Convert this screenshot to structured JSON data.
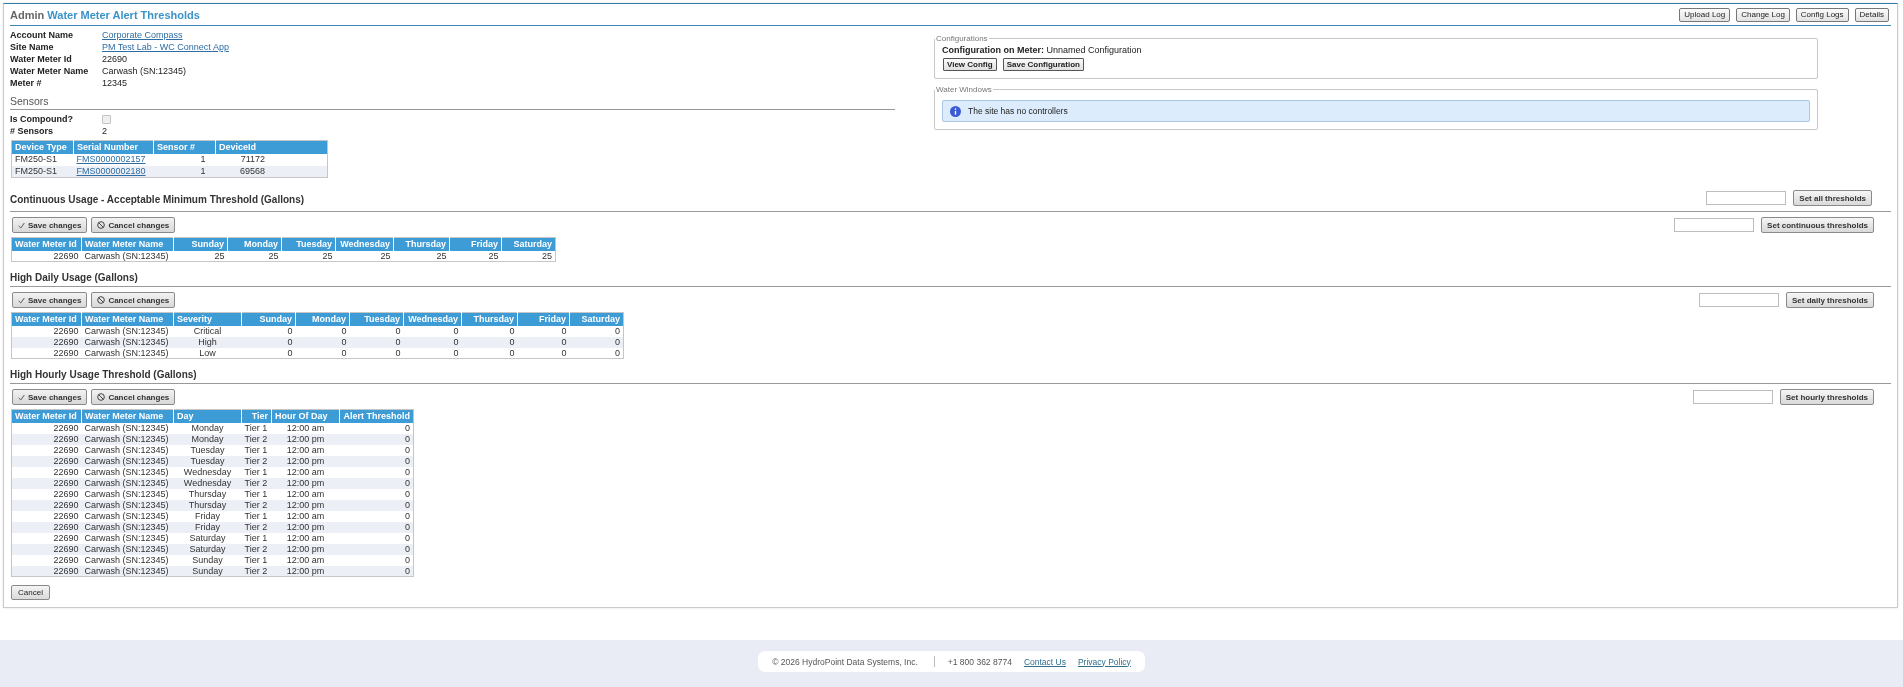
{
  "header": {
    "title": {
      "prefix": "Admin",
      "main": "Water Meter Alert Thresholds"
    },
    "buttons": [
      "Upload Log",
      "Change Log",
      "Config Logs",
      "Details"
    ]
  },
  "details": [
    {
      "label": "Account Name",
      "value": "Corporate Compass",
      "kind": "link"
    },
    {
      "label": "Site Name",
      "value": "PM Test Lab - WC Connect App",
      "kind": "link"
    },
    {
      "label": "Water Meter Id",
      "value": "22690",
      "kind": "text"
    },
    {
      "label": "Water Meter Name",
      "value": "Carwash (SN:12345)",
      "kind": "text"
    },
    {
      "label": "Meter #",
      "value": "12345",
      "kind": "text"
    }
  ],
  "sensors": {
    "title": "Sensors",
    "compound": {
      "label": "Is Compound?",
      "checked": false,
      "disabled": true
    },
    "count": {
      "label": "# Sensors",
      "value": "2"
    },
    "table": {
      "columns": [
        "Device Type",
        "Serial Number",
        "Sensor #",
        "DeviceId"
      ],
      "rows": [
        [
          "FM250-S1",
          "FMS0000002157",
          "1",
          "71172"
        ],
        [
          "FM250-S1",
          "FMS0000002180",
          "1",
          "69568"
        ]
      ]
    }
  },
  "configurations": {
    "legend": "Configurations",
    "label": "Configuration on Meter:",
    "value": "Unnamed Configuration",
    "buttons": [
      "View Config",
      "Save Configuration"
    ]
  },
  "water_windows": {
    "legend": "Water Windows",
    "message": "The site has no controllers"
  },
  "sections": [
    {
      "kind": "continuous",
      "title": "Continuous Usage - Acceptable Minimum Threshold (Gallons)",
      "header_action": "Set all thresholds",
      "buttons": [
        {
          "kind": "save",
          "label": "Save changes"
        },
        {
          "kind": "cancel",
          "label": "Cancel changes"
        }
      ],
      "set_button": "Set continuous thresholds",
      "table": {
        "columns": [
          "Water Meter Id",
          "Water Meter Name",
          "Sunday",
          "Monday",
          "Tuesday",
          "Wednesday",
          "Thursday",
          "Friday",
          "Saturday"
        ],
        "rows": [
          [
            "22690",
            "Carwash (SN:12345)",
            "25",
            "25",
            "25",
            "25",
            "25",
            "25",
            "25"
          ]
        ]
      }
    },
    {
      "kind": "daily",
      "title": "High Daily Usage (Gallons)",
      "buttons": [
        {
          "kind": "save",
          "label": "Save changes"
        },
        {
          "kind": "cancel",
          "label": "Cancel changes"
        }
      ],
      "set_button": "Set daily thresholds",
      "table": {
        "columns": [
          "Water Meter Id",
          "Water Meter Name",
          "Severity",
          "Sunday",
          "Monday",
          "Tuesday",
          "Wednesday",
          "Thursday",
          "Friday",
          "Saturday"
        ],
        "rows": [
          [
            "22690",
            "Carwash (SN:12345)",
            "Critical",
            "0",
            "0",
            "0",
            "0",
            "0",
            "0",
            "0"
          ],
          [
            "22690",
            "Carwash (SN:12345)",
            "High",
            "0",
            "0",
            "0",
            "0",
            "0",
            "0",
            "0"
          ],
          [
            "22690",
            "Carwash (SN:12345)",
            "Low",
            "0",
            "0",
            "0",
            "0",
            "0",
            "0",
            "0"
          ]
        ]
      }
    },
    {
      "kind": "hourly",
      "title": "High Hourly Usage Threshold (Gallons)",
      "buttons": [
        {
          "kind": "save",
          "label": "Save changes"
        },
        {
          "kind": "cancel",
          "label": "Cancel changes"
        }
      ],
      "set_button": "Set hourly thresholds",
      "table": {
        "columns": [
          "Water Meter Id",
          "Water Meter Name",
          "Day",
          "Tier",
          "Hour Of Day",
          "Alert Threshold"
        ],
        "rows": [
          [
            "22690",
            "Carwash (SN:12345)",
            "Monday",
            "Tier 1",
            "12:00 am",
            "0"
          ],
          [
            "22690",
            "Carwash (SN:12345)",
            "Monday",
            "Tier 2",
            "12:00 pm",
            "0"
          ],
          [
            "22690",
            "Carwash (SN:12345)",
            "Tuesday",
            "Tier 1",
            "12:00 am",
            "0"
          ],
          [
            "22690",
            "Carwash (SN:12345)",
            "Tuesday",
            "Tier 2",
            "12:00 pm",
            "0"
          ],
          [
            "22690",
            "Carwash (SN:12345)",
            "Wednesday",
            "Tier 1",
            "12:00 am",
            "0"
          ],
          [
            "22690",
            "Carwash (SN:12345)",
            "Wednesday",
            "Tier 2",
            "12:00 pm",
            "0"
          ],
          [
            "22690",
            "Carwash (SN:12345)",
            "Thursday",
            "Tier 1",
            "12:00 am",
            "0"
          ],
          [
            "22690",
            "Carwash (SN:12345)",
            "Thursday",
            "Tier 2",
            "12:00 pm",
            "0"
          ],
          [
            "22690",
            "Carwash (SN:12345)",
            "Friday",
            "Tier 1",
            "12:00 am",
            "0"
          ],
          [
            "22690",
            "Carwash (SN:12345)",
            "Friday",
            "Tier 2",
            "12:00 pm",
            "0"
          ],
          [
            "22690",
            "Carwash (SN:12345)",
            "Saturday",
            "Tier 1",
            "12:00 am",
            "0"
          ],
          [
            "22690",
            "Carwash (SN:12345)",
            "Saturday",
            "Tier 2",
            "12:00 pm",
            "0"
          ],
          [
            "22690",
            "Carwash (SN:12345)",
            "Sunday",
            "Tier 1",
            "12:00 am",
            "0"
          ],
          [
            "22690",
            "Carwash (SN:12345)",
            "Sunday",
            "Tier 2",
            "12:00 pm",
            "0"
          ]
        ]
      }
    }
  ],
  "cancel_button": "Cancel",
  "footer": {
    "copyright": "© 2026 HydroPoint Data Systems, Inc.",
    "phone": "+1 800 362 8774",
    "links": [
      "Contact Us",
      "Privacy Policy"
    ]
  }
}
